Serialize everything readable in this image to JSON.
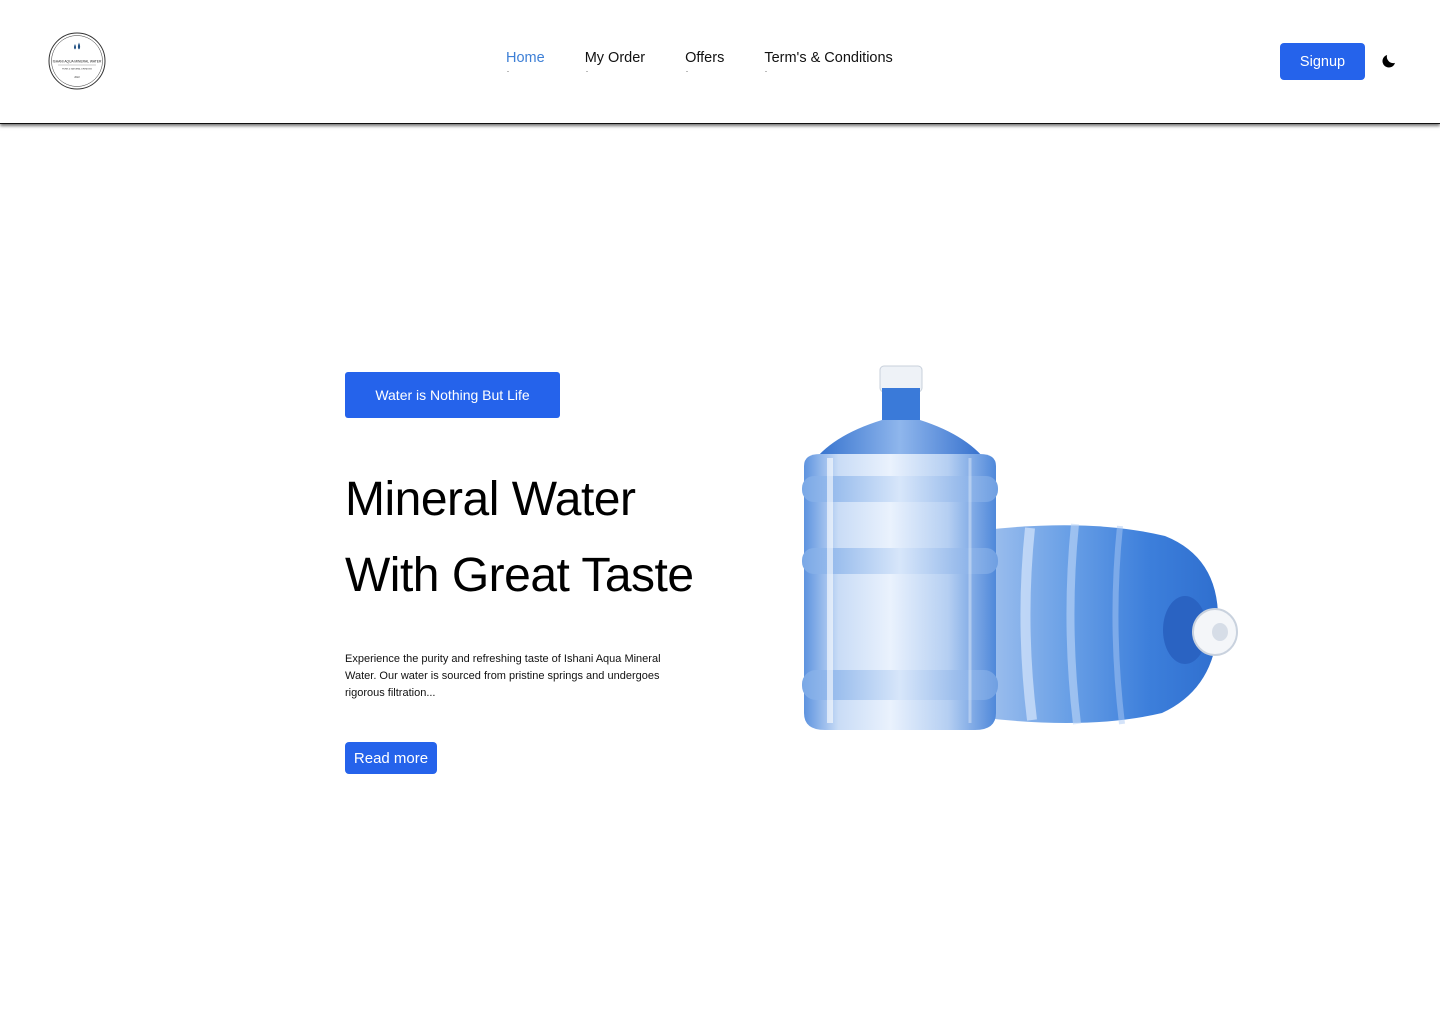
{
  "header": {
    "logo": {
      "name": "ISHANI AQUA MINERAL WATER",
      "tagline": "PURE & NATURAL DRINKING",
      "since": "2022"
    },
    "nav": [
      {
        "label": "Home",
        "active": true
      },
      {
        "label": "My Order",
        "active": false
      },
      {
        "label": "Offers",
        "active": false
      },
      {
        "label": "Term's & Conditions",
        "active": false
      }
    ],
    "signup_label": "Signup",
    "theme_icon": "moon-icon"
  },
  "hero": {
    "tagline": "Water is Nothing But Life",
    "title_line1": "Mineral Water",
    "title_line2": "With Great Taste",
    "description": "Experience the purity and refreshing taste of Ishani Aqua Mineral Water. Our water is sourced from pristine springs and undergoes rigorous filtration...",
    "read_more_label": "Read more",
    "image": "water-bottles-image"
  },
  "colors": {
    "accent": "#2563eb",
    "nav_active": "#3d7fd6",
    "background": "#ffffff",
    "text": "#000000"
  }
}
